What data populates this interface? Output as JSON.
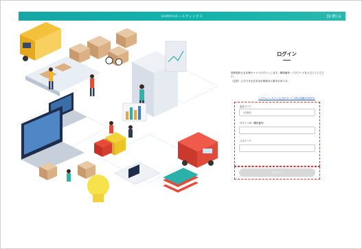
{
  "header": {
    "brand": "SOMPOホールディングス",
    "close_label": "閉じる"
  },
  "login": {
    "title": "ログイン",
    "intro": "団体契約せるま様サイトへログインします。職員番号・パスワードを入力してください。",
    "notice": "（注意）入力できる文字は半角英字と数字のみです。",
    "help_link": "システムメンテナンスに伴うサービス停止情報のお知らせ",
    "company_code_label": "会社コード",
    "company_code_value": "（未選択）",
    "login_id_label": "ログインID（職員番号）",
    "password_label": "パスワード",
    "login_button": "ログイン"
  },
  "colors": {
    "header_start": "#16a6a6",
    "header_end": "#2bb8ad",
    "highlight": "#e52a2a",
    "button_disabled": "#d8d8d8"
  }
}
